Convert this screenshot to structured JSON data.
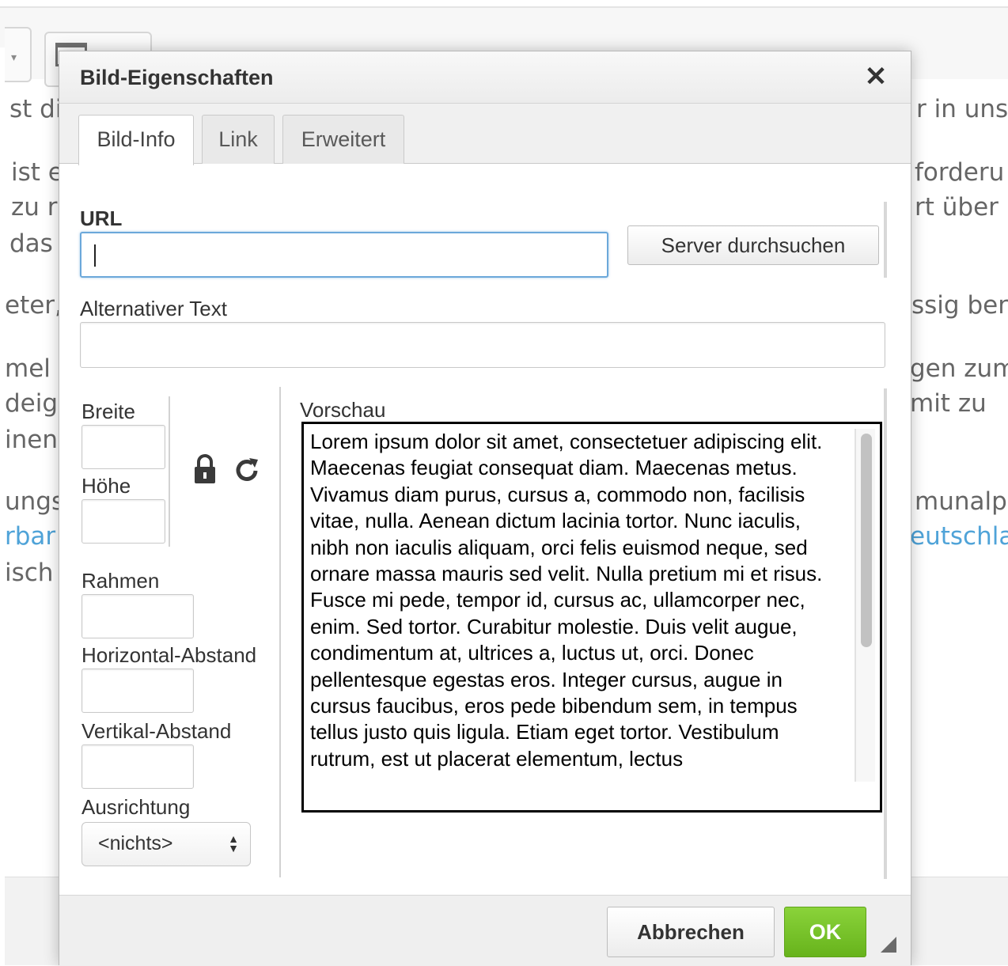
{
  "background": {
    "lines": [
      {
        "left": "st di",
        "right": "r in uns"
      },
      {
        "left": "ist e",
        "right": "forderu"
      },
      {
        "left": "zu r",
        "right": "rt über"
      },
      {
        "left": "das",
        "right": ""
      },
      {
        "left": "eter,",
        "right": "ssig ber"
      },
      {
        "left": "mel",
        "right": "gen zum"
      },
      {
        "left": "deig",
        "right": "mit zu"
      },
      {
        "left": "inen",
        "right": ""
      },
      {
        "left": "ungs",
        "right": "munalp"
      },
      {
        "left": "rbar",
        "right": "eutschla"
      },
      {
        "left": "isch",
        "right": ""
      }
    ]
  },
  "dialog": {
    "title": "Bild-Eigenschaften",
    "close_glyph": "✕",
    "tabs": [
      "Bild-Info",
      "Link",
      "Erweitert"
    ],
    "url": {
      "label": "URL",
      "value": ""
    },
    "browse_button": "Server durchsuchen",
    "alt_text": {
      "label": "Alternativer Text",
      "value": ""
    },
    "width": {
      "label": "Breite",
      "value": ""
    },
    "height": {
      "label": "Höhe",
      "value": ""
    },
    "border": {
      "label": "Rahmen",
      "value": ""
    },
    "hspace": {
      "label": "Horizontal-Abstand",
      "value": ""
    },
    "vspace": {
      "label": "Vertikal-Abstand",
      "value": ""
    },
    "align": {
      "label": "Ausrichtung",
      "value": "<nichts>"
    },
    "preview": {
      "label": "Vorschau",
      "text": "Lorem ipsum dolor sit amet, consectetuer adipiscing elit. Maecenas feugiat consequat diam. Maecenas metus. Vivamus diam purus, cursus a, commodo non, facilisis vitae, nulla. Aenean dictum lacinia tortor. Nunc iaculis, nibh non iaculis aliquam, orci felis euismod neque, sed ornare massa mauris sed velit. Nulla pretium mi et risus. Fusce mi pede, tempor id, cursus ac, ullamcorper nec, enim. Sed tortor. Curabitur molestie. Duis velit augue, condimentum at, ultrices a, luctus ut, orci. Donec pellentesque egestas eros. Integer cursus, augue in cursus faucibus, eros pede bibendum sem, in tempus tellus justo quis ligula. Etiam eget tortor. Vestibulum rutrum, est ut placerat elementum, lectus"
    },
    "lock_icon": "lock-icon",
    "reset_icon": "reset-size-icon",
    "buttons": {
      "cancel": "Abbrechen",
      "ok": "OK"
    }
  }
}
